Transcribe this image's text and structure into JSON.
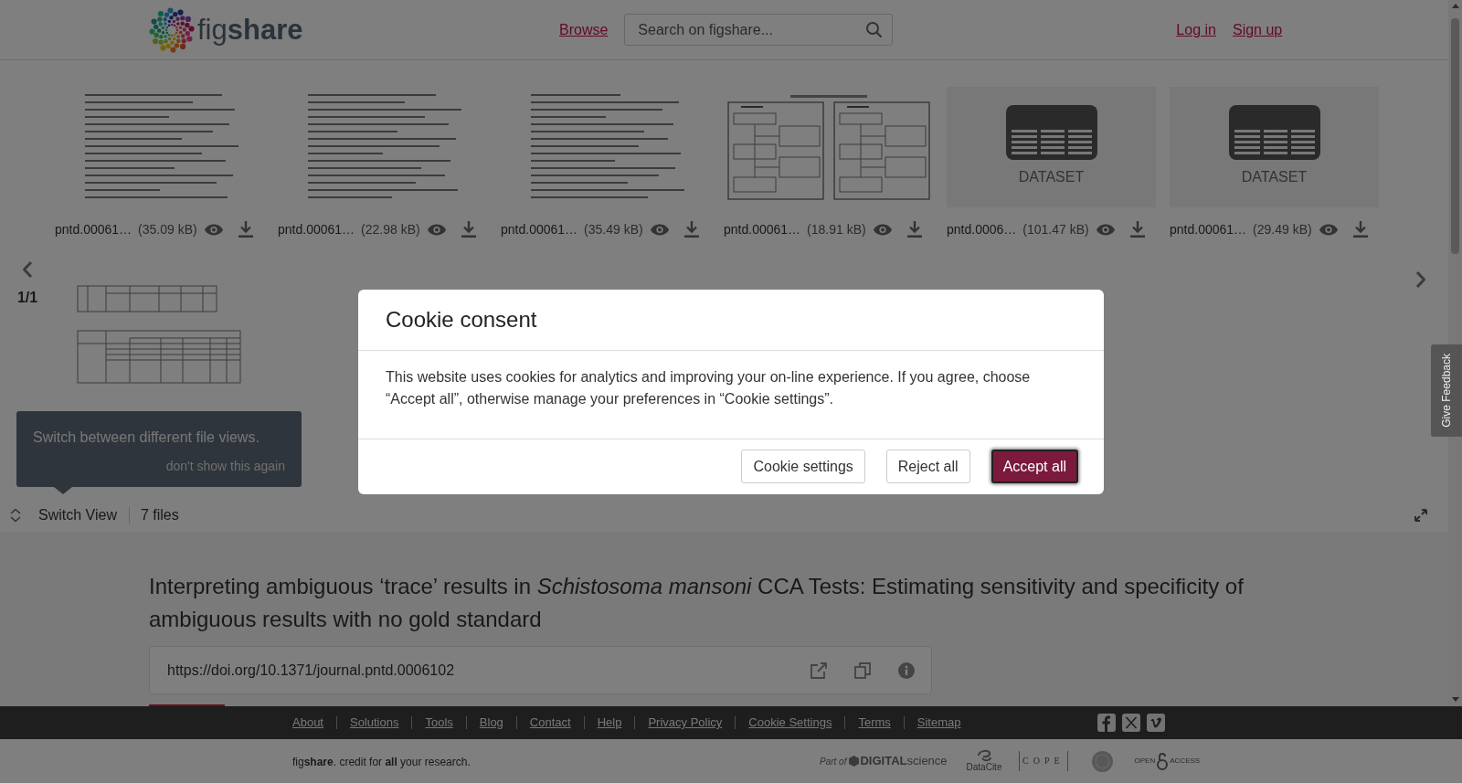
{
  "header": {
    "logo_text": "fig**share**",
    "nav_links": [
      {
        "label": "Browse"
      }
    ],
    "search": {
      "placeholder": "Search on figshare..."
    },
    "account_links": [
      {
        "label": "Log in"
      },
      {
        "label": "Sign up"
      }
    ]
  },
  "file_viewer": {
    "page_counter": "1/1",
    "files": [
      {
        "kind": "document",
        "name": "pntd.00061…",
        "size": "(35.09 kB)"
      },
      {
        "kind": "document",
        "name": "pntd.00061…",
        "size": "(22.98 kB)"
      },
      {
        "kind": "document",
        "name": "pntd.00061…",
        "size": "(35.49 kB)"
      },
      {
        "kind": "diagram",
        "name": "pntd.00061…",
        "size": "(18.91 kB)"
      },
      {
        "kind": "dataset",
        "type_label": "DATASET",
        "name": "pntd.0006…",
        "size": "(101.47 kB)"
      },
      {
        "kind": "dataset",
        "type_label": "DATASET",
        "name": "pntd.00061…",
        "size": "(29.49 kB)"
      },
      {
        "kind": "table"
      }
    ],
    "tooltip": {
      "message": "Switch between different file views.",
      "dismiss": "don't show this again"
    },
    "toolbar": {
      "switch_view": "Switch View",
      "file_count": "7 files"
    }
  },
  "article": {
    "title": "Interpreting ambiguous ‘trace’ results in *Schistosoma mansoni* CCA Tests: Estimating sensitivity and specificity of ambiguous results with no gold standard",
    "doi": "https://doi.org/10.1371/journal.pntd.0006102"
  },
  "feedback_tab": {
    "label": "Give Feedback"
  },
  "footer": {
    "links": [
      "About",
      "Solutions",
      "Tools",
      "Blog",
      "Contact",
      "Help",
      "Privacy Policy",
      "Cookie Settings",
      "Terms",
      "Sitemap"
    ],
    "social": [
      {
        "kind": "facebook"
      },
      {
        "kind": "x"
      },
      {
        "kind": "vimeo"
      }
    ],
    "tagline": "fig**share**. credit for **all** your research.",
    "partners": [
      {
        "kind": "digital_science",
        "caption": "Part of",
        "name": "**DIGITAL**science"
      },
      {
        "kind": "datacite",
        "name": "DataCite"
      },
      {
        "kind": "cope",
        "name": "COPE"
      },
      {
        "kind": "seal"
      },
      {
        "kind": "open_access",
        "label_left": "OPEN",
        "label_right": "ACCESS"
      }
    ]
  },
  "cookie_dialog": {
    "title": "Cookie consent",
    "message": "This website uses cookies for analytics and improving your on-line experience. If you agree, choose “Accept all”, otherwise manage your preferences in “Cookie settings”.",
    "buttons": [
      {
        "label": "Cookie settings",
        "kind": "secondary",
        "focused": false
      },
      {
        "label": "Reject all",
        "kind": "secondary",
        "focused": false
      },
      {
        "label": "Accept all",
        "kind": "primary",
        "focused": true
      }
    ]
  }
}
